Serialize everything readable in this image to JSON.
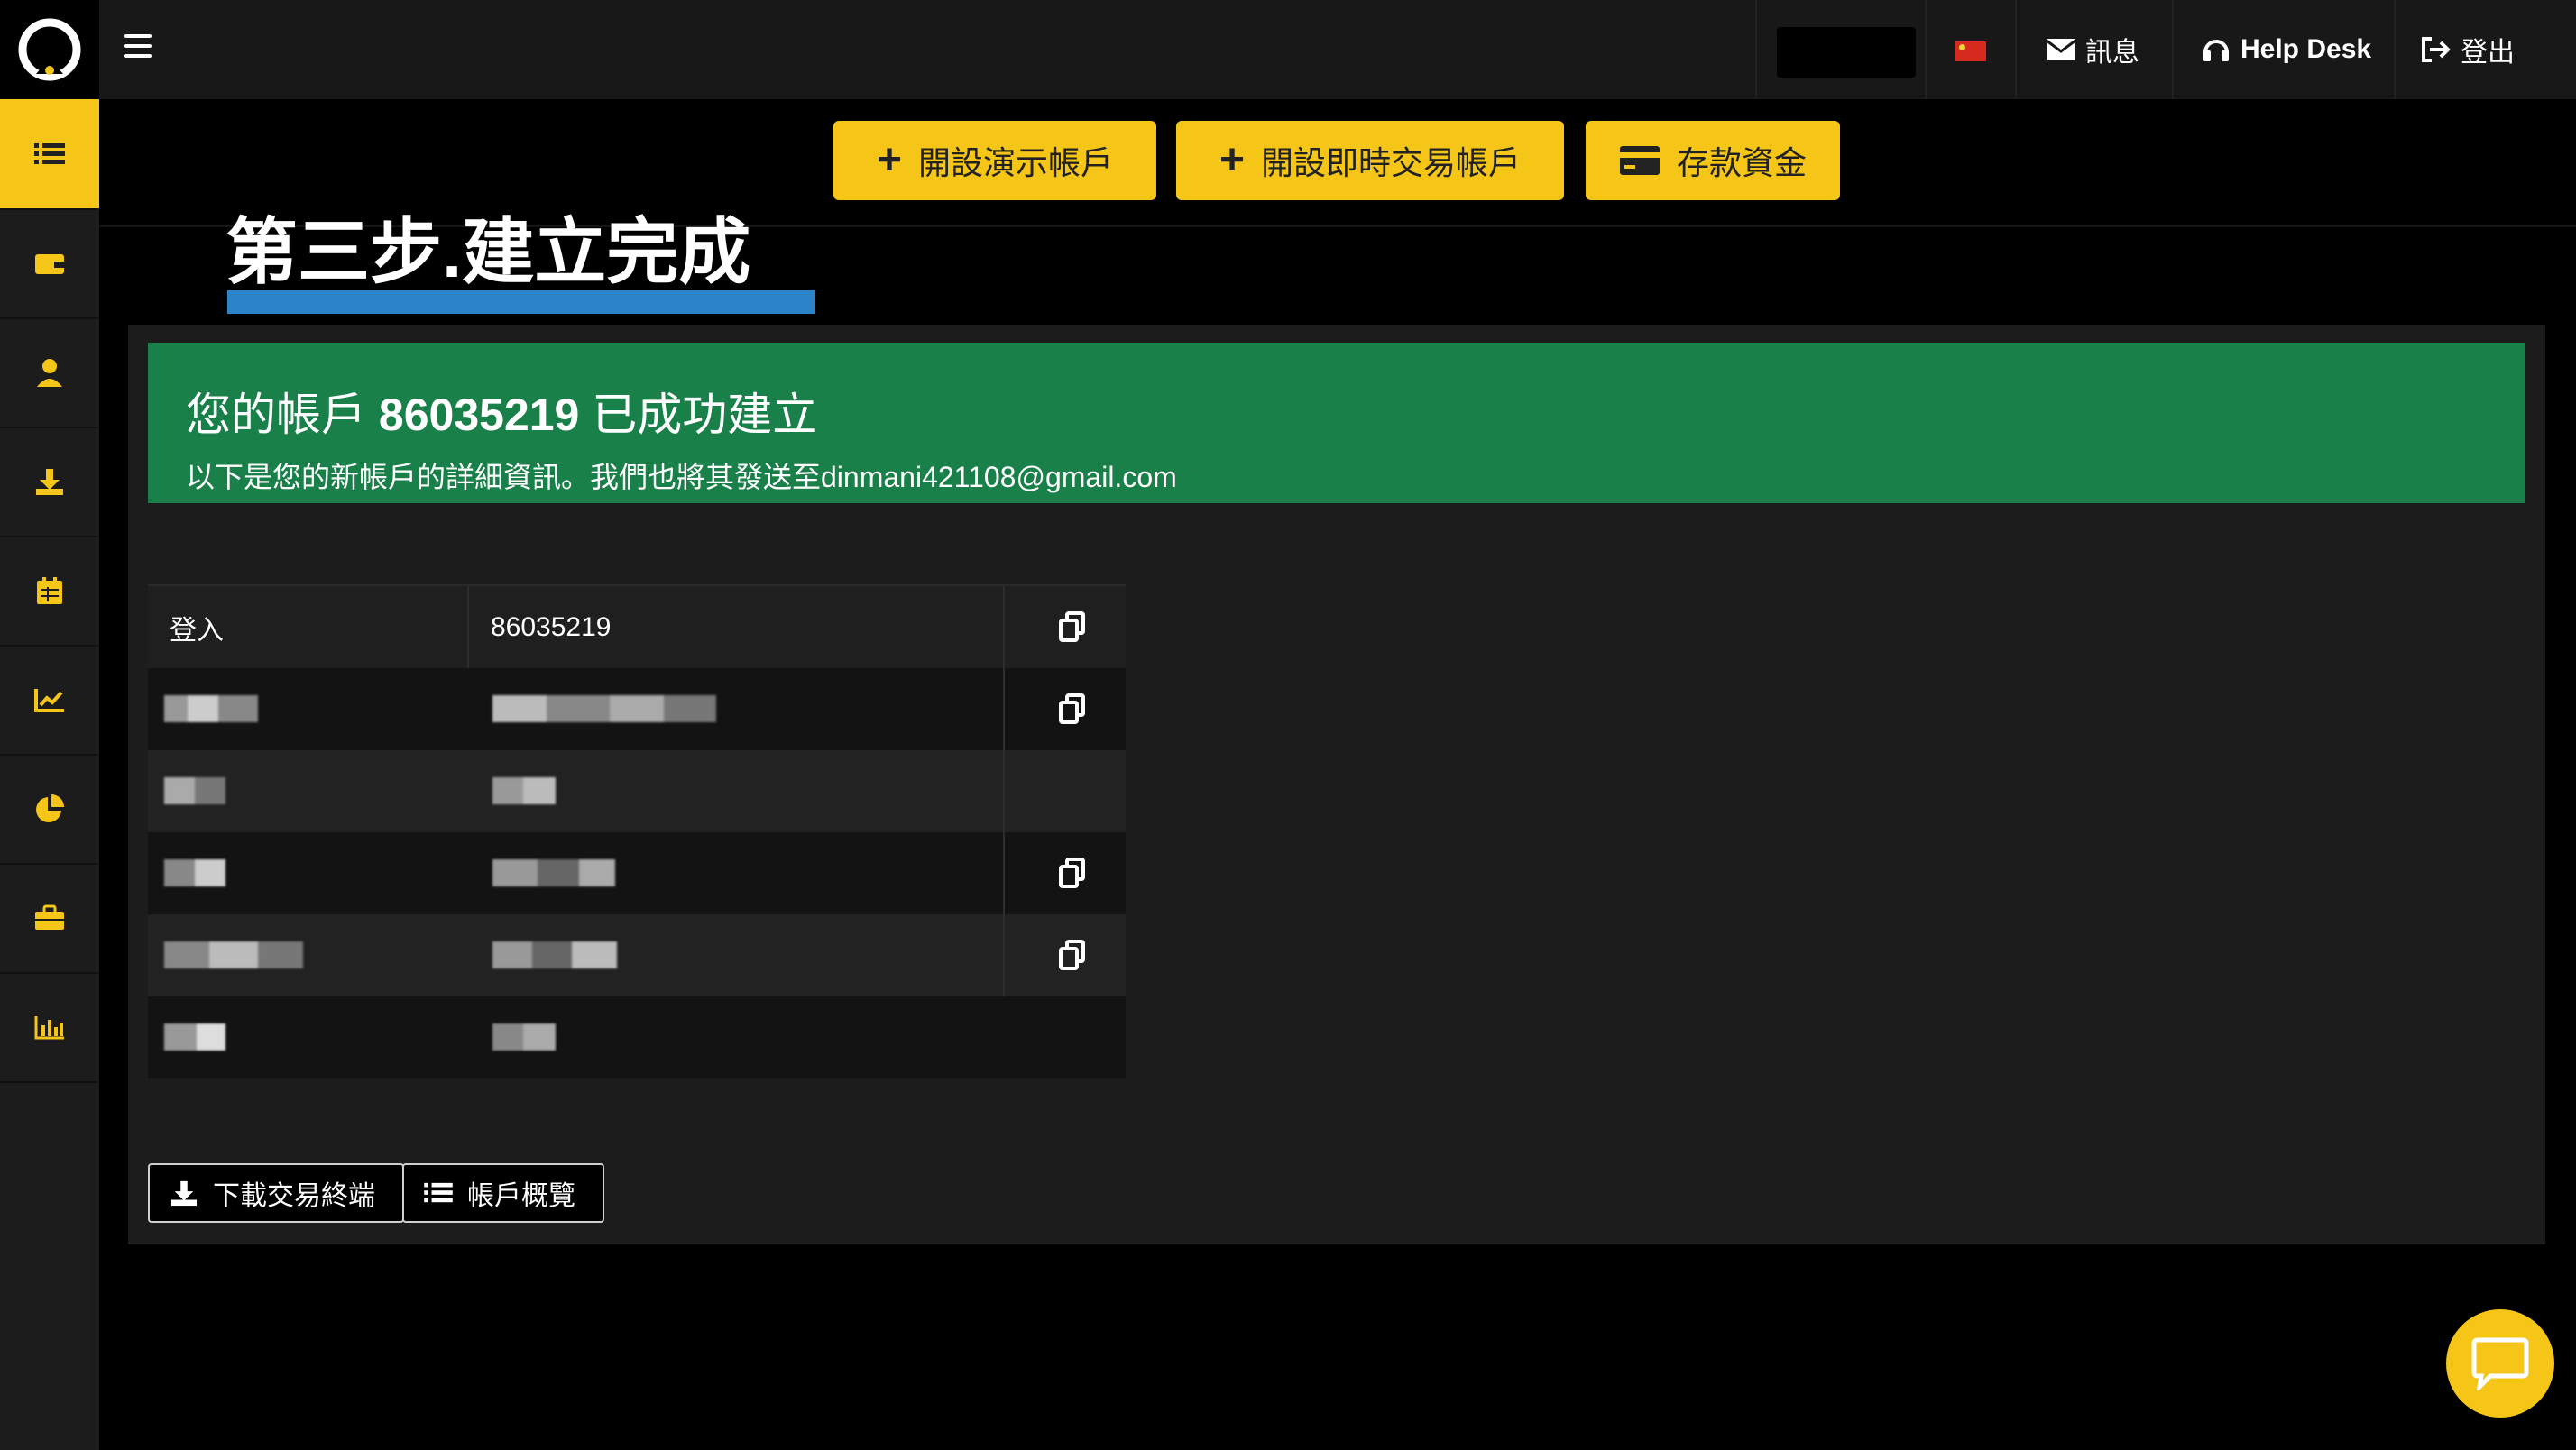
{
  "topbar": {
    "messages_label": "訊息",
    "helpdesk_label": "Help Desk",
    "logout_label": "登出"
  },
  "toolbar": {
    "demo_account_label": "開設演示帳戶",
    "live_account_label": "開設即時交易帳戶",
    "deposit_label": "存款資金"
  },
  "step_title": "第三步.建立完成",
  "alert": {
    "title_prefix": "您的帳戶",
    "account_number": "86035219",
    "title_suffix": "已成功建立",
    "subtitle": "以下是您的新帳戶的詳細資訊。我們也將其發送至dinmani421108@gmail.com"
  },
  "details": {
    "login_label": "登入",
    "login_value": "86035219"
  },
  "buttons": {
    "download_terminal": "下載交易終端",
    "account_overview": "帳戶概覽"
  },
  "colors": {
    "accent": "#f5c518",
    "success": "#1a8049",
    "underline": "#2a84c7"
  },
  "icons": [
    "menu-icon",
    "list-icon",
    "wallet-icon",
    "user-icon",
    "download-icon",
    "calendar-icon",
    "chart-line-icon",
    "pie-chart-icon",
    "briefcase-icon",
    "bar-chart-icon",
    "envelope-icon",
    "headset-icon",
    "logout-icon",
    "plus-icon",
    "credit-card-icon",
    "copy-icon",
    "chat-icon"
  ]
}
